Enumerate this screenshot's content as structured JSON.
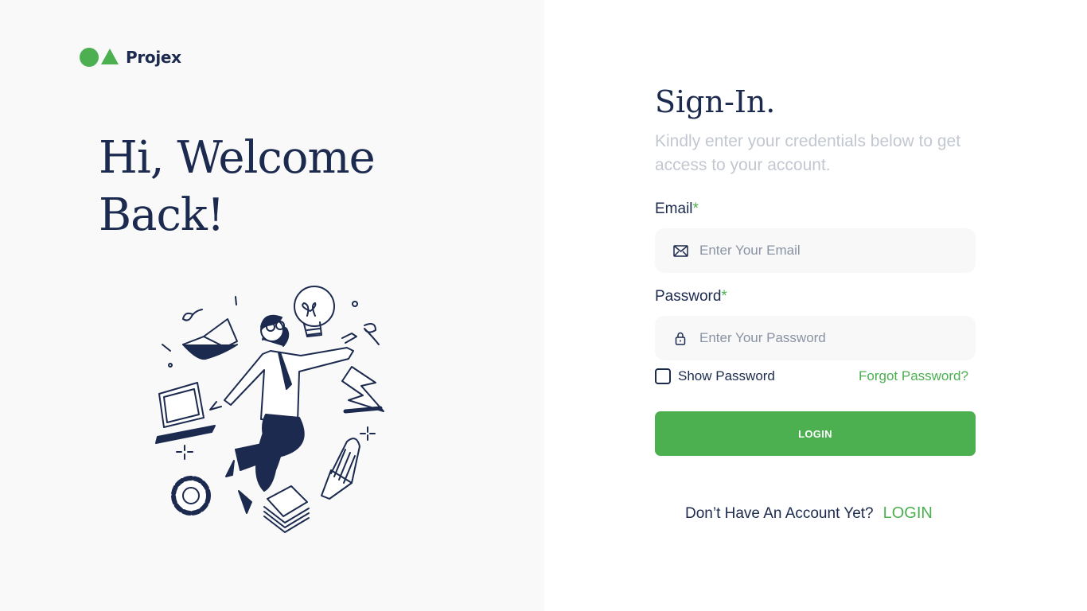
{
  "brand": {
    "name": "Projex",
    "color": "#4caf50",
    "dark": "#1b2a4e"
  },
  "left": {
    "welcome": "Hi, Welcome Back!"
  },
  "form": {
    "title": "Sign-In.",
    "subtitle": "Kindly enter your credentials below to get access to your account.",
    "email": {
      "label": "Email",
      "required_mark": "*",
      "placeholder": "Enter Your Email",
      "value": "",
      "icon": "mail-icon"
    },
    "password": {
      "label": "Password",
      "required_mark": "*",
      "placeholder": "Enter Your Password",
      "value": "",
      "icon": "lock-icon"
    },
    "show_password": {
      "label": "Show Password",
      "checked": false
    },
    "forgot_password": "Forgot Password?",
    "login_button": "LOGIN",
    "no_account_text": "Don’t Have An Account Yet?",
    "no_account_link": "LOGIN"
  }
}
